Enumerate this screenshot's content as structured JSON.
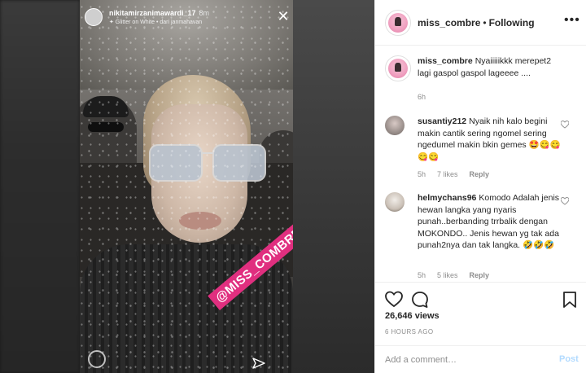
{
  "story": {
    "username": "nikitamirzanimawardi_17",
    "time": "8m",
    "filter_text": "✦ Glitter on White • dari janmahavan",
    "tag": "@MISS_COMBRE"
  },
  "post": {
    "username": "miss_combre",
    "follow_status": "Following",
    "more_label": "•••",
    "caption_user": "miss_combre",
    "caption_text": "Nyaiiiiikkk merepet2 lagi gaspol gaspol lageeee ....",
    "caption_time": "6h",
    "comments": [
      {
        "user": "susantiy212",
        "text": "Nyaik nih kalo begini makin cantik sering ngomel sering ngedumel makin bkin gemes 🤩😋😋😋😋",
        "time": "5h",
        "likes": "7 likes",
        "reply": "Reply"
      },
      {
        "user": "helmychans96",
        "text": "Komodo Adalah jenis hewan langka yang nyaris punah..berbanding trrbalik dengan MOKONDO.. Jenis hewan yg tak ada punah2nya dan tak langka. 🤣🤣🤣",
        "time": "5h",
        "likes": "5 likes",
        "reply": "Reply"
      }
    ],
    "views": "26,646 views",
    "posted": "6 HOURS AGO",
    "add_comment_placeholder": "Add a comment…",
    "post_label": "Post"
  },
  "colors": {
    "tag_bg": "#e02f7f",
    "post_disabled": "#b3dbff",
    "muted_text": "#8e8e8e"
  }
}
